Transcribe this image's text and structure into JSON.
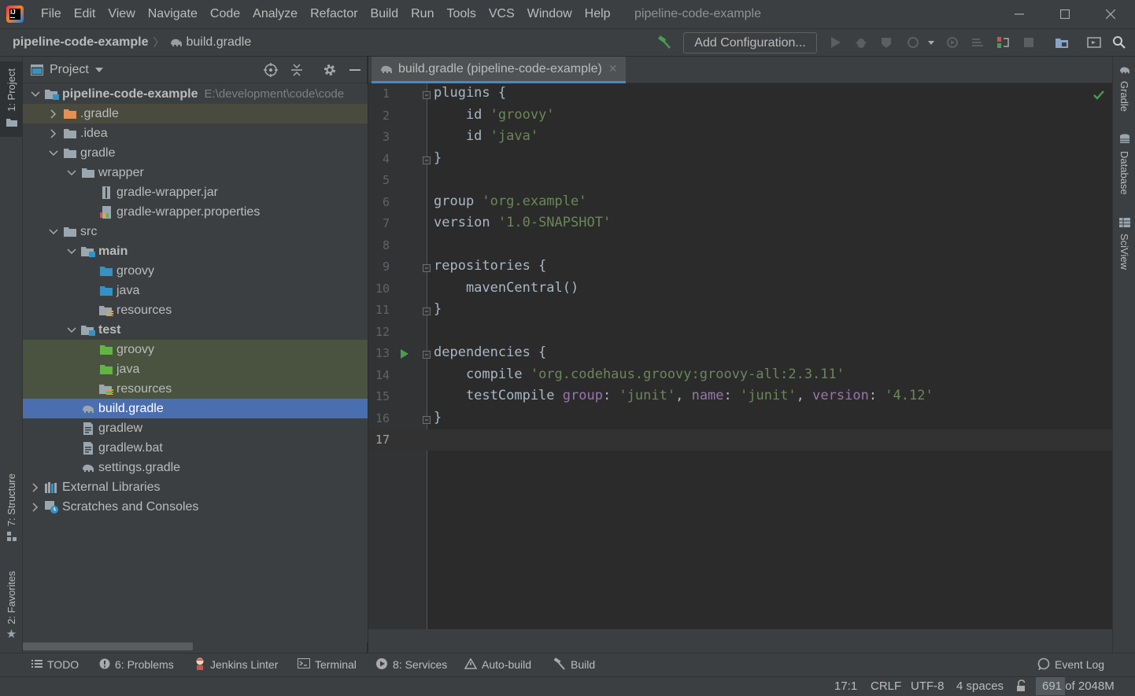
{
  "menu": [
    "File",
    "Edit",
    "View",
    "Navigate",
    "Code",
    "Analyze",
    "Refactor",
    "Build",
    "Run",
    "Tools",
    "VCS",
    "Window",
    "Help"
  ],
  "window_title": "pipeline-code-example",
  "breadcrumb": {
    "project": "pipeline-code-example",
    "file": "build.gradle"
  },
  "run_config": {
    "label": "Add Configuration..."
  },
  "left_strip": {
    "project": "1: Project",
    "structure": "7: Structure",
    "favorites": "2: Favorites"
  },
  "project_panel": {
    "title": "Project"
  },
  "tree": [
    {
      "label": "pipeline-code-example",
      "path": "E:\\development\\code\\code",
      "chev": "down",
      "icon": "module-folder",
      "indent": 0,
      "bold": true
    },
    {
      "label": ".gradle",
      "chev": "right",
      "icon": "folder-excluded",
      "indent": 1,
      "style": "hl"
    },
    {
      "label": ".idea",
      "chev": "right",
      "icon": "folder",
      "indent": 1
    },
    {
      "label": "gradle",
      "chev": "down",
      "icon": "folder",
      "indent": 1
    },
    {
      "label": "wrapper",
      "chev": "down",
      "icon": "folder",
      "indent": 2
    },
    {
      "label": "gradle-wrapper.jar",
      "chev": "",
      "icon": "jar-file",
      "indent": 3
    },
    {
      "label": "gradle-wrapper.properties",
      "chev": "",
      "icon": "properties-file",
      "indent": 3
    },
    {
      "label": "src",
      "chev": "down",
      "icon": "folder",
      "indent": 1
    },
    {
      "label": "main",
      "chev": "down",
      "icon": "module-folder",
      "indent": 2,
      "bold": true
    },
    {
      "label": "groovy",
      "chev": "",
      "icon": "source-folder",
      "indent": 3
    },
    {
      "label": "java",
      "chev": "",
      "icon": "source-folder",
      "indent": 3
    },
    {
      "label": "resources",
      "chev": "",
      "icon": "resources-folder",
      "indent": 3
    },
    {
      "label": "test",
      "chev": "down",
      "icon": "module-folder",
      "indent": 2,
      "bold": true
    },
    {
      "label": "groovy",
      "chev": "",
      "icon": "test-folder",
      "indent": 3,
      "style": "tst"
    },
    {
      "label": "java",
      "chev": "",
      "icon": "test-folder",
      "indent": 3,
      "style": "tst"
    },
    {
      "label": "resources",
      "chev": "",
      "icon": "test-resources-folder",
      "indent": 3,
      "style": "tst"
    },
    {
      "label": "build.gradle",
      "chev": "",
      "icon": "gradle-file",
      "indent": 2,
      "style": "sel"
    },
    {
      "label": "gradlew",
      "chev": "",
      "icon": "script-file",
      "indent": 2
    },
    {
      "label": "gradlew.bat",
      "chev": "",
      "icon": "script-file",
      "indent": 2
    },
    {
      "label": "settings.gradle",
      "chev": "",
      "icon": "gradle-file",
      "indent": 2
    },
    {
      "label": "External Libraries",
      "chev": "right",
      "icon": "libraries",
      "indent": 0
    },
    {
      "label": "Scratches and Consoles",
      "chev": "right",
      "icon": "scratches",
      "indent": 0
    }
  ],
  "editor": {
    "tab_label": "build.gradle (pipeline-code-example)",
    "lines": [
      [
        {
          "t": "plugins {"
        }
      ],
      [
        {
          "t": "    id "
        },
        {
          "t": "'groovy'",
          "c": "str"
        }
      ],
      [
        {
          "t": "    id "
        },
        {
          "t": "'java'",
          "c": "str"
        }
      ],
      [
        {
          "t": "}"
        }
      ],
      [],
      [
        {
          "t": "group "
        },
        {
          "t": "'org.example'",
          "c": "str"
        }
      ],
      [
        {
          "t": "version "
        },
        {
          "t": "'1.0-SNAPSHOT'",
          "c": "str"
        }
      ],
      [],
      [
        {
          "t": "repositories {"
        }
      ],
      [
        {
          "t": "    mavenCentral()"
        }
      ],
      [
        {
          "t": "}"
        }
      ],
      [],
      [
        {
          "t": "dependencies {"
        }
      ],
      [
        {
          "t": "    compile "
        },
        {
          "t": "'org.codehaus.groovy:groovy-all:2.3.11'",
          "c": "str"
        }
      ],
      [
        {
          "t": "    testCompile "
        },
        {
          "t": "group",
          "c": "nm"
        },
        {
          "t": ": "
        },
        {
          "t": "'junit'",
          "c": "str"
        },
        {
          "t": ", "
        },
        {
          "t": "name",
          "c": "nm"
        },
        {
          "t": ": "
        },
        {
          "t": "'junit'",
          "c": "str"
        },
        {
          "t": ", "
        },
        {
          "t": "version",
          "c": "nm"
        },
        {
          "t": ": "
        },
        {
          "t": "'4.12'",
          "c": "str"
        }
      ],
      [
        {
          "t": "}"
        }
      ],
      []
    ],
    "current_line": 17,
    "run_gutter_line": 13
  },
  "right_strip": {
    "gradle": "Gradle",
    "database": "Database",
    "sciview": "SciView"
  },
  "bottom_tools": {
    "todo": "TODO",
    "problems": "6: Problems",
    "jenkins": "Jenkins Linter",
    "terminal": "Terminal",
    "services": "8: Services",
    "autobuild": "Auto-build",
    "build": "Build",
    "eventlog": "Event Log"
  },
  "status": {
    "position": "17:1",
    "line_sep": "CRLF",
    "encoding": "UTF-8",
    "indent": "4 spaces",
    "memory_used": "691",
    "memory_total": " of 2048M",
    "memory_fraction": 0.34
  },
  "colors": {
    "accent": "#4b6eaf",
    "string": "#6a8759",
    "named_arg": "#9876aa",
    "run_green": "#499c54"
  }
}
